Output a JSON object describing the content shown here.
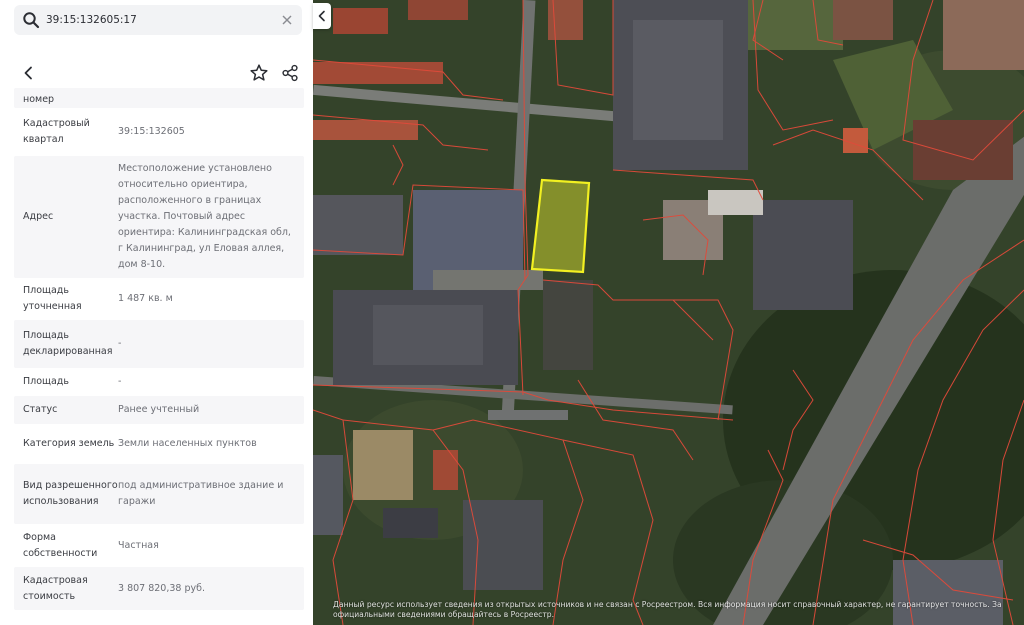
{
  "search": {
    "value": "39:15:132605:17",
    "icon": "search-icon",
    "clear_icon": "close-icon"
  },
  "toolbar": {
    "back_icon": "chevron-left-icon",
    "favorite_icon": "star-icon",
    "share_icon": "share-icon"
  },
  "details": [
    {
      "label": "номер",
      "value": ""
    },
    {
      "label": "Кадастровый квартал",
      "value": "39:15:132605"
    },
    {
      "label": "Адрес",
      "value": "Местоположение установлено относительно ориентира, расположенного в границах участка. Почтовый адрес ориентира: Калининградская обл, г Калининград, ул Еловая аллея, дом 8-10."
    },
    {
      "label": "Площадь уточненная",
      "value": "1 487 кв. м"
    },
    {
      "label": "Площадь декларированная",
      "value": "-"
    },
    {
      "label": "Площадь",
      "value": "-"
    },
    {
      "label": "Статус",
      "value": "Ранее учтенный"
    },
    {
      "label": "Категория земель",
      "value": "Земли населенных пунктов"
    },
    {
      "label": "Вид разрешенного использования",
      "value": "под административное здание и гаражи"
    },
    {
      "label": "Форма собственности",
      "value": "Частная"
    },
    {
      "label": "Кадастровая стоимость",
      "value": "3 807 820,38 руб."
    }
  ],
  "map": {
    "collapse_icon": "chevron-left-icon",
    "parcel_border_color": "#e04a3a",
    "selected_parcel_color": "#f2f021",
    "disclaimer": "Данный ресурс использует сведения из открытых источников и не связан с Росреестром. Вся информация носит справочный характер, не гарантирует точность. За официальными сведениями обращайтесь в Росреестр."
  },
  "colors": {
    "panel_bg": "#ffffff",
    "row_shade": "#f6f6f8",
    "label_text": "#3a3c42",
    "value_text": "#6d6f76"
  }
}
